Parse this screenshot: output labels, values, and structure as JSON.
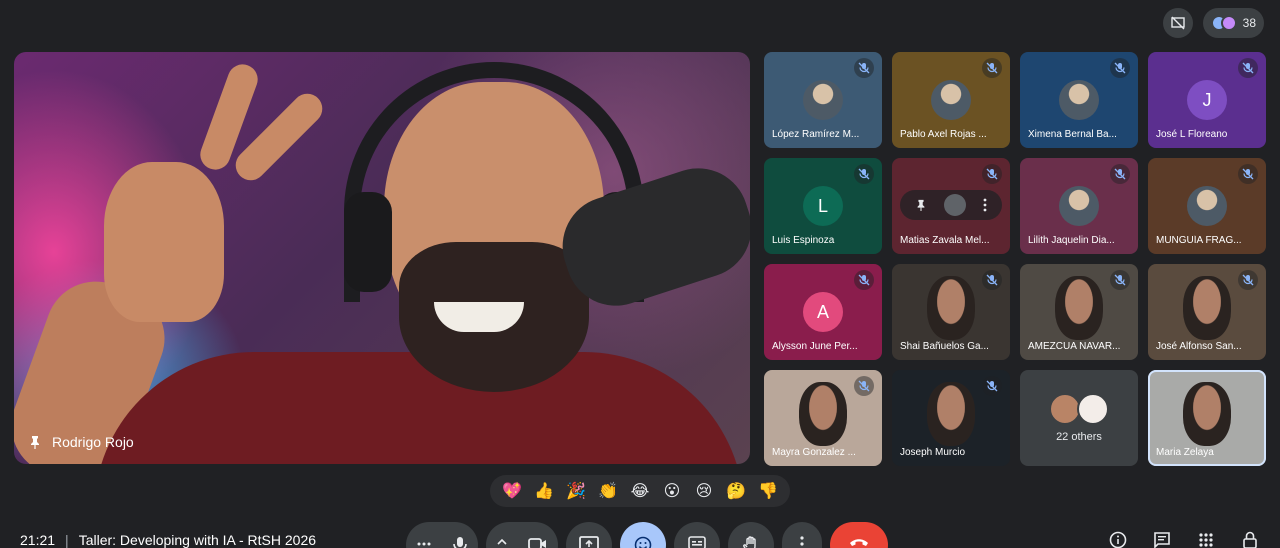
{
  "top": {
    "participant_count": "38",
    "icons": [
      "presentation-off-icon",
      "participants-icon"
    ]
  },
  "main": {
    "speaker_name": "Rodrigo Rojo",
    "pinned": true
  },
  "tiles": [
    {
      "name": "López Ramírez M...",
      "kind": "photo",
      "color": "#3d5a74",
      "muted": true
    },
    {
      "name": "Pablo Axel Rojas ...",
      "kind": "photo",
      "color": "#6b5223",
      "muted": true
    },
    {
      "name": "Ximena Bernal Ba...",
      "kind": "photo",
      "color": "#1e4670",
      "muted": true
    },
    {
      "name": "José L Floreano",
      "kind": "letter",
      "letter": "J",
      "color": "#5b2f8f",
      "avatar_color": "#7e4ec2",
      "muted": true
    },
    {
      "name": "Luis Espinoza",
      "kind": "letter",
      "letter": "L",
      "color": "#0f4c3e",
      "avatar_color": "#0d6b55",
      "muted": true
    },
    {
      "name": "Matias Zavala Mel...",
      "kind": "hover",
      "color": "#5d2530",
      "muted": true
    },
    {
      "name": "Lilith Jaquelin Dia...",
      "kind": "photo",
      "color": "#6a2f4b",
      "muted": true
    },
    {
      "name": "MUNGUÍA FRAG...",
      "kind": "photo",
      "color": "#5b3b28",
      "muted": true
    },
    {
      "name": "Alysson June Per...",
      "kind": "letter",
      "letter": "A",
      "color": "#8a1d4c",
      "avatar_color": "#e24a7d",
      "muted": true
    },
    {
      "name": "Shai Bañuelos Ga...",
      "kind": "video",
      "color": "#3a3531",
      "muted": true
    },
    {
      "name": "AMEZCUA NAVAR...",
      "kind": "video",
      "color": "#4f4a44",
      "muted": true
    },
    {
      "name": "José Alfonso San...",
      "kind": "video",
      "color": "#5a4b3e",
      "muted": true
    },
    {
      "name": "Mayra Gonzalez ...",
      "kind": "video",
      "color": "#b9a79a",
      "muted": true
    },
    {
      "name": "Joseph Murcio",
      "kind": "video",
      "color": "#1c2228",
      "muted": true
    },
    {
      "name": "22 others",
      "kind": "others",
      "color": "#3c4043",
      "muted": false
    },
    {
      "name": "Maria Zelaya",
      "kind": "video",
      "color": "#a9aaa8",
      "muted": false,
      "selected": true
    }
  ],
  "reactions": [
    "💖",
    "👍",
    "🎉",
    "👏",
    "😂",
    "😮",
    "😢",
    "🤔",
    "👎"
  ],
  "bottom": {
    "time": "21:21",
    "separator": "|",
    "meeting_title": "Taller: Developing with IA - RtSH 2026"
  },
  "colors": {
    "background": "#202124",
    "control": "#3c4043",
    "active": "#a8c7fa",
    "end_call": "#ea4335"
  }
}
